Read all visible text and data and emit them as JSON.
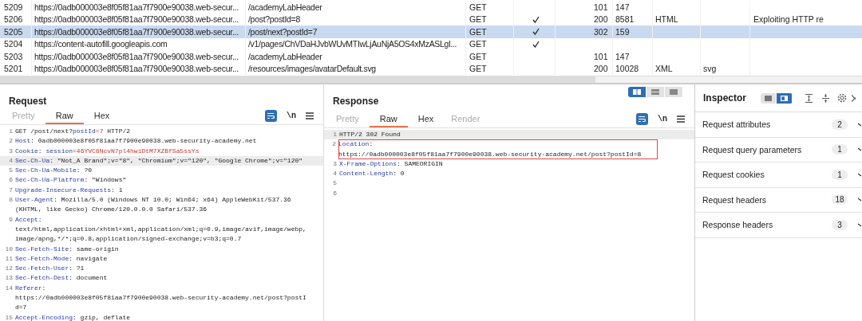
{
  "table": {
    "rows": [
      {
        "selected": false,
        "column_1": "5209",
        "column_2": "https://0adb000003e8f05f81aa7f7900e90038.web-secur...",
        "column_3": "/academyLabHeader",
        "column_4": "GET",
        "column_5": false,
        "column_6": "101",
        "column_7": "147"
      },
      {
        "selected": false,
        "column_1": "5206",
        "column_2": "https://0adb000003e8f05f81aa7f7900e90038.web-secur...",
        "column_3": "/post?postId=8",
        "column_4": "GET",
        "column_5": true,
        "column_6": "200",
        "column_7": "8581",
        "column_8": "HTML",
        "column_10": "Exploiting HTTP re"
      },
      {
        "selected": true,
        "column_1": "5205",
        "column_2": "https://0adb000003e8f05f81aa7f7900e90038.web-secur...",
        "column_3": "/post/next?postId=7",
        "column_4": "GET",
        "column_5": true,
        "column_6": "302",
        "column_7": "159"
      },
      {
        "selected": false,
        "column_1": "5204",
        "column_2": "https://content-autofill.googleapis.com",
        "column_3": "/v1/pages/ChVDaHJvbWUvMTIwLjAuNjA5OS4xMzASLgl...",
        "column_4": "GET",
        "column_5": true
      },
      {
        "selected": false,
        "column_1": "5203",
        "column_2": "https://0adb000003e8f05f81aa7f7900e90038.web-secur...",
        "column_3": "/academyLabHeader",
        "column_4": "GET",
        "column_5": false,
        "column_6": "101",
        "column_7": "147"
      },
      {
        "selected": false,
        "column_1": "5201",
        "column_2": "https://0adb000003e8f05f81aa7f7900e90038.web-secur...",
        "column_3": "/resources/images/avatarDefault.svg",
        "column_4": "GET",
        "column_5": false,
        "column_6": "200",
        "column_7": "10028",
        "column_8": "XML",
        "column_9": "svg"
      }
    ]
  },
  "request": {
    "title": "Request",
    "tabs": [
      {
        "label": "Pretty",
        "selected": false,
        "disabled": true
      },
      {
        "label": "Raw",
        "selected": true,
        "disabled": false
      },
      {
        "label": "Hex",
        "selected": false,
        "disabled": false
      }
    ],
    "wrap_selected": true,
    "newline_label": "\\n",
    "lines": [
      {
        "number": "1",
        "highlighted": false,
        "boxed": false,
        "rows": [
          [
            {
              "kind": "text",
              "text": "GET /post/next?"
            },
            {
              "kind": "key",
              "text": "postId"
            },
            {
              "kind": "value",
              "text": "=7"
            },
            {
              "kind": "text",
              "text": " HTTP/2"
            }
          ]
        ]
      },
      {
        "number": "2",
        "highlighted": false,
        "boxed": false,
        "rows": [
          [
            {
              "kind": "key",
              "text": "Host"
            },
            {
              "kind": "text",
              "text": ": 0adb000003e8f05f81aa7f7900e90038.web-security-academy.net"
            }
          ]
        ]
      },
      {
        "number": "3",
        "highlighted": false,
        "boxed": false,
        "rows": [
          [
            {
              "kind": "key",
              "text": "Cookie"
            },
            {
              "kind": "text",
              "text": ": "
            },
            {
              "kind": "key",
              "text": "session"
            },
            {
              "kind": "value",
              "text": "=46YVC8NcvN7pl4hwiDtM7XZBfSa5ssYs"
            }
          ]
        ]
      },
      {
        "number": "4",
        "highlighted": true,
        "boxed": false,
        "rows": [
          [
            {
              "kind": "key",
              "text": "Sec-Ch-Ua"
            },
            {
              "kind": "text",
              "text": ": \"Not_A Brand\";v=\"8\", \"Chromium\";v=\"120\", \"Google Chrome\";v=\"120\""
            }
          ]
        ]
      },
      {
        "number": "5",
        "highlighted": false,
        "boxed": false,
        "rows": [
          [
            {
              "kind": "key",
              "text": "Sec-Ch-Ua-Mobile"
            },
            {
              "kind": "text",
              "text": ": ?0"
            }
          ]
        ]
      },
      {
        "number": "6",
        "highlighted": false,
        "boxed": false,
        "rows": [
          [
            {
              "kind": "key",
              "text": "Sec-Ch-Ua-Platform"
            },
            {
              "kind": "text",
              "text": ": \"Windows\""
            }
          ]
        ]
      },
      {
        "number": "7",
        "highlighted": false,
        "boxed": false,
        "rows": [
          [
            {
              "kind": "key",
              "text": "Upgrade-Insecure-Requests"
            },
            {
              "kind": "text",
              "text": ": 1"
            }
          ]
        ]
      },
      {
        "number": "8",
        "highlighted": false,
        "boxed": false,
        "rows": [
          [
            {
              "kind": "key",
              "text": "User-Agent"
            },
            {
              "kind": "text",
              "text": ": Mozilla/5.0 (Windows NT 10.0; Win64; x64) AppleWebKit/537.36"
            }
          ],
          [
            {
              "kind": "text",
              "text": "(KHTML, like Gecko) Chrome/120.0.0.0 Safari/537.36"
            }
          ]
        ]
      },
      {
        "number": "9",
        "highlighted": false,
        "boxed": false,
        "rows": [
          [
            {
              "kind": "key",
              "text": "Accept"
            },
            {
              "kind": "text",
              "text": ":"
            }
          ],
          [
            {
              "kind": "text",
              "text": "text/html,application/xhtml+xml,application/xml;q=0.9,image/avif,image/webp,"
            }
          ],
          [
            {
              "kind": "text",
              "text": "image/apng,*/*;q=0.8,application/signed-exchange;v=b3;q=0.7"
            }
          ]
        ]
      },
      {
        "number": "10",
        "highlighted": false,
        "boxed": false,
        "rows": [
          [
            {
              "kind": "key",
              "text": "Sec-Fetch-Site"
            },
            {
              "kind": "text",
              "text": ": same-origin"
            }
          ]
        ]
      },
      {
        "number": "11",
        "highlighted": false,
        "boxed": false,
        "rows": [
          [
            {
              "kind": "key",
              "text": "Sec-Fetch-Mode"
            },
            {
              "kind": "text",
              "text": ": navigate"
            }
          ]
        ]
      },
      {
        "number": "12",
        "highlighted": false,
        "boxed": false,
        "rows": [
          [
            {
              "kind": "key",
              "text": "Sec-Fetch-User"
            },
            {
              "kind": "text",
              "text": ": ?1"
            }
          ]
        ]
      },
      {
        "number": "13",
        "highlighted": false,
        "boxed": false,
        "rows": [
          [
            {
              "kind": "key",
              "text": "Sec-Fetch-Dest"
            },
            {
              "kind": "text",
              "text": ": document"
            }
          ]
        ]
      },
      {
        "number": "14",
        "highlighted": false,
        "boxed": false,
        "rows": [
          [
            {
              "kind": "key",
              "text": "Referer"
            },
            {
              "kind": "text",
              "text": ":"
            }
          ],
          [
            {
              "kind": "text",
              "text": "https://0adb000003e8f05f81aa7f7900e90038.web-security-academy.net/post?postI"
            }
          ],
          [
            {
              "kind": "text",
              "text": "d=7"
            }
          ]
        ]
      },
      {
        "number": "15",
        "highlighted": false,
        "boxed": false,
        "rows": [
          [
            {
              "kind": "key",
              "text": "Accept-Encoding"
            },
            {
              "kind": "text",
              "text": ": gzip, deflate"
            }
          ]
        ]
      }
    ]
  },
  "response": {
    "title": "Response",
    "layouts": [
      {
        "selected": true
      },
      {
        "selected": false
      },
      {
        "selected": false
      }
    ],
    "tabs": [
      {
        "label": "Pretty",
        "selected": false,
        "disabled": true
      },
      {
        "label": "Raw",
        "selected": true,
        "disabled": false
      },
      {
        "label": "Hex",
        "selected": false,
        "disabled": false
      },
      {
        "label": "Render",
        "selected": false,
        "disabled": true
      }
    ],
    "wrap_selected": true,
    "newline_label": "\\n",
    "lines": [
      {
        "number": "1",
        "highlighted": true,
        "boxed": false,
        "rows": [
          [
            {
              "kind": "text",
              "text": "HTTP/2 302 Found"
            }
          ]
        ]
      },
      {
        "number": "2",
        "highlighted": false,
        "boxed": true,
        "rows": [
          [
            {
              "kind": "key",
              "text": "Location"
            },
            {
              "kind": "text",
              "text": ":"
            }
          ],
          [
            {
              "kind": "text",
              "text": "https://0adb000003e8f05f81aa7f7900e90038.web-security-academy.net/post?postId=8"
            }
          ]
        ]
      },
      {
        "number": "3",
        "highlighted": false,
        "boxed": false,
        "rows": [
          [
            {
              "kind": "key",
              "text": "X-Frame-Options"
            },
            {
              "kind": "text",
              "text": ": SAMEORIGIN"
            }
          ]
        ]
      },
      {
        "number": "4",
        "highlighted": false,
        "boxed": false,
        "rows": [
          [
            {
              "kind": "key",
              "text": "Content-Length"
            },
            {
              "kind": "text",
              "text": ": 0"
            }
          ]
        ]
      },
      {
        "number": "5",
        "highlighted": false,
        "boxed": false
      },
      {
        "number": "6",
        "highlighted": false,
        "boxed": false
      }
    ]
  },
  "inspector": {
    "title": "Inspector",
    "layouts": [
      {
        "selected": false
      },
      {
        "selected": true
      }
    ],
    "sections": [
      {
        "label": "Request attributes",
        "count": "2"
      },
      {
        "label": "Request query parameters",
        "count": "1"
      },
      {
        "label": "Request cookies",
        "count": "1"
      },
      {
        "label": "Request headers",
        "count": "18"
      },
      {
        "label": "Response headers",
        "count": "3"
      }
    ]
  }
}
